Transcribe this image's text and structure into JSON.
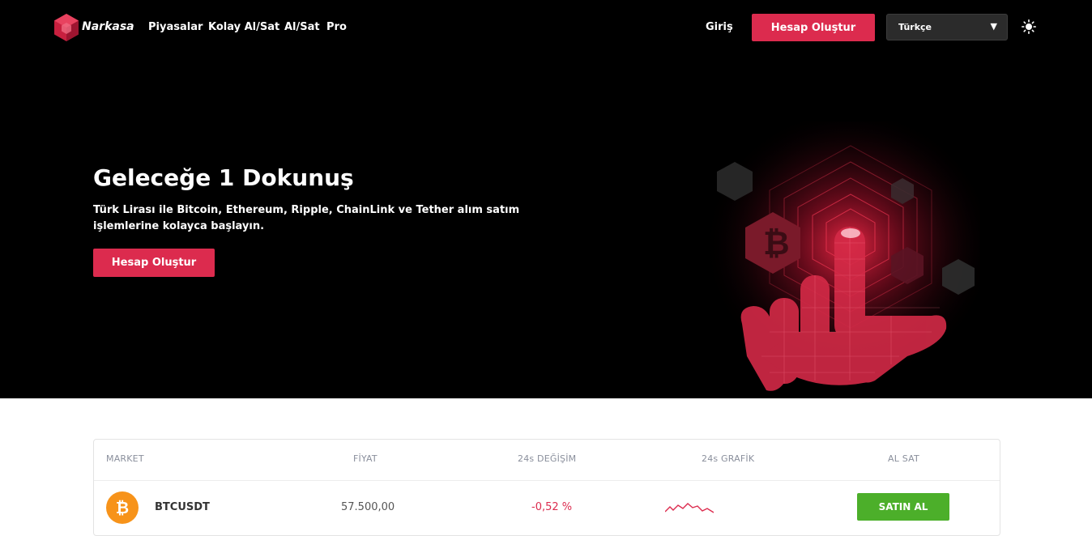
{
  "nav": {
    "brand": "Narkasa",
    "links": [
      "Piyasalar",
      "Kolay Al/Sat",
      "Al/Sat",
      "Pro"
    ],
    "login": "Giriş",
    "signup": "Hesap Oluştur",
    "language": "Türkçe",
    "theme_icon": "sun-icon"
  },
  "hero": {
    "title": "Geleceğe 1 Dokunuş",
    "subtitle": "Türk Lirası ile Bitcoin, Ethereum, Ripple, ChainLink ve Tether alım satım işlemlerine kolayca başlayın.",
    "cta": "Hesap Oluştur"
  },
  "market": {
    "headers": [
      "MARKET",
      "FİYAT",
      "24s DEĞİŞİM",
      "24s GRAFİK",
      "AL SAT"
    ],
    "rows": [
      {
        "pair": "BTCUSDT",
        "price": "57.500,00",
        "change": "-0,52 %",
        "action": "SATIN AL"
      }
    ]
  },
  "colors": {
    "accent": "#dc2b4e",
    "buy": "#4caf2a",
    "bitcoin": "#f7931a",
    "hero_bg": "#000000"
  }
}
